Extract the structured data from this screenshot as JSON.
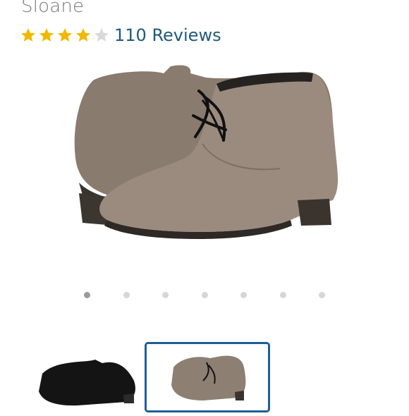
{
  "product": {
    "name": "Sloane"
  },
  "rating": {
    "stars_filled": 4,
    "stars_total": 5,
    "reviews_label": "110 Reviews"
  },
  "gallery": {
    "image_count": 7,
    "active_index": 0
  },
  "thumbnails": [
    {
      "color": "black",
      "selected": false
    },
    {
      "color": "taupe",
      "selected": true
    }
  ],
  "colors": {
    "star": "#f2b800",
    "star_empty": "#d9d9d9",
    "link": "#1f5a7a",
    "accent": "#1d5f9a"
  }
}
